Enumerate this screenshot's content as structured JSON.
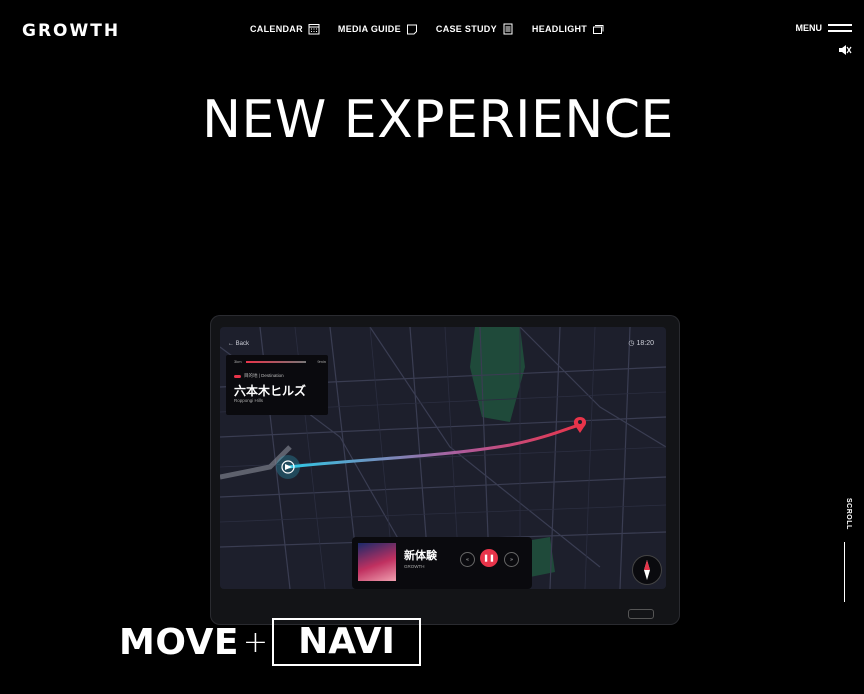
{
  "header": {
    "logo": "GROWTH",
    "nav": [
      {
        "label": "CALENDAR",
        "icon": "calendar-icon"
      },
      {
        "label": "MEDIA GUIDE",
        "icon": "tablet-icon"
      },
      {
        "label": "CASE STUDY",
        "icon": "document-icon"
      },
      {
        "label": "HEADLIGHT",
        "icon": "stack-icon"
      }
    ],
    "menu_label": "MENU"
  },
  "hero": {
    "headline": "NEW EXPERIENCE"
  },
  "device_screen": {
    "back_label": "← Back",
    "clock": "18:20",
    "distance_left": "3km",
    "distance_right": "9min",
    "dest_label": "目的地 | Destination",
    "dest_name_jp": "六本木ヒルズ",
    "dest_name_en": "Roppongi Hills",
    "player_title": "新体験",
    "player_artist": "GROWTH"
  },
  "side": {
    "scroll_label": "SCROLL"
  },
  "tagline": {
    "move": "MOVE",
    "plus": "+",
    "navi": "NAVI"
  },
  "colors": {
    "background": "#000000",
    "accent": "#e8344a",
    "route_start": "#2ec9e6",
    "map_bg": "#1d1f2c"
  }
}
